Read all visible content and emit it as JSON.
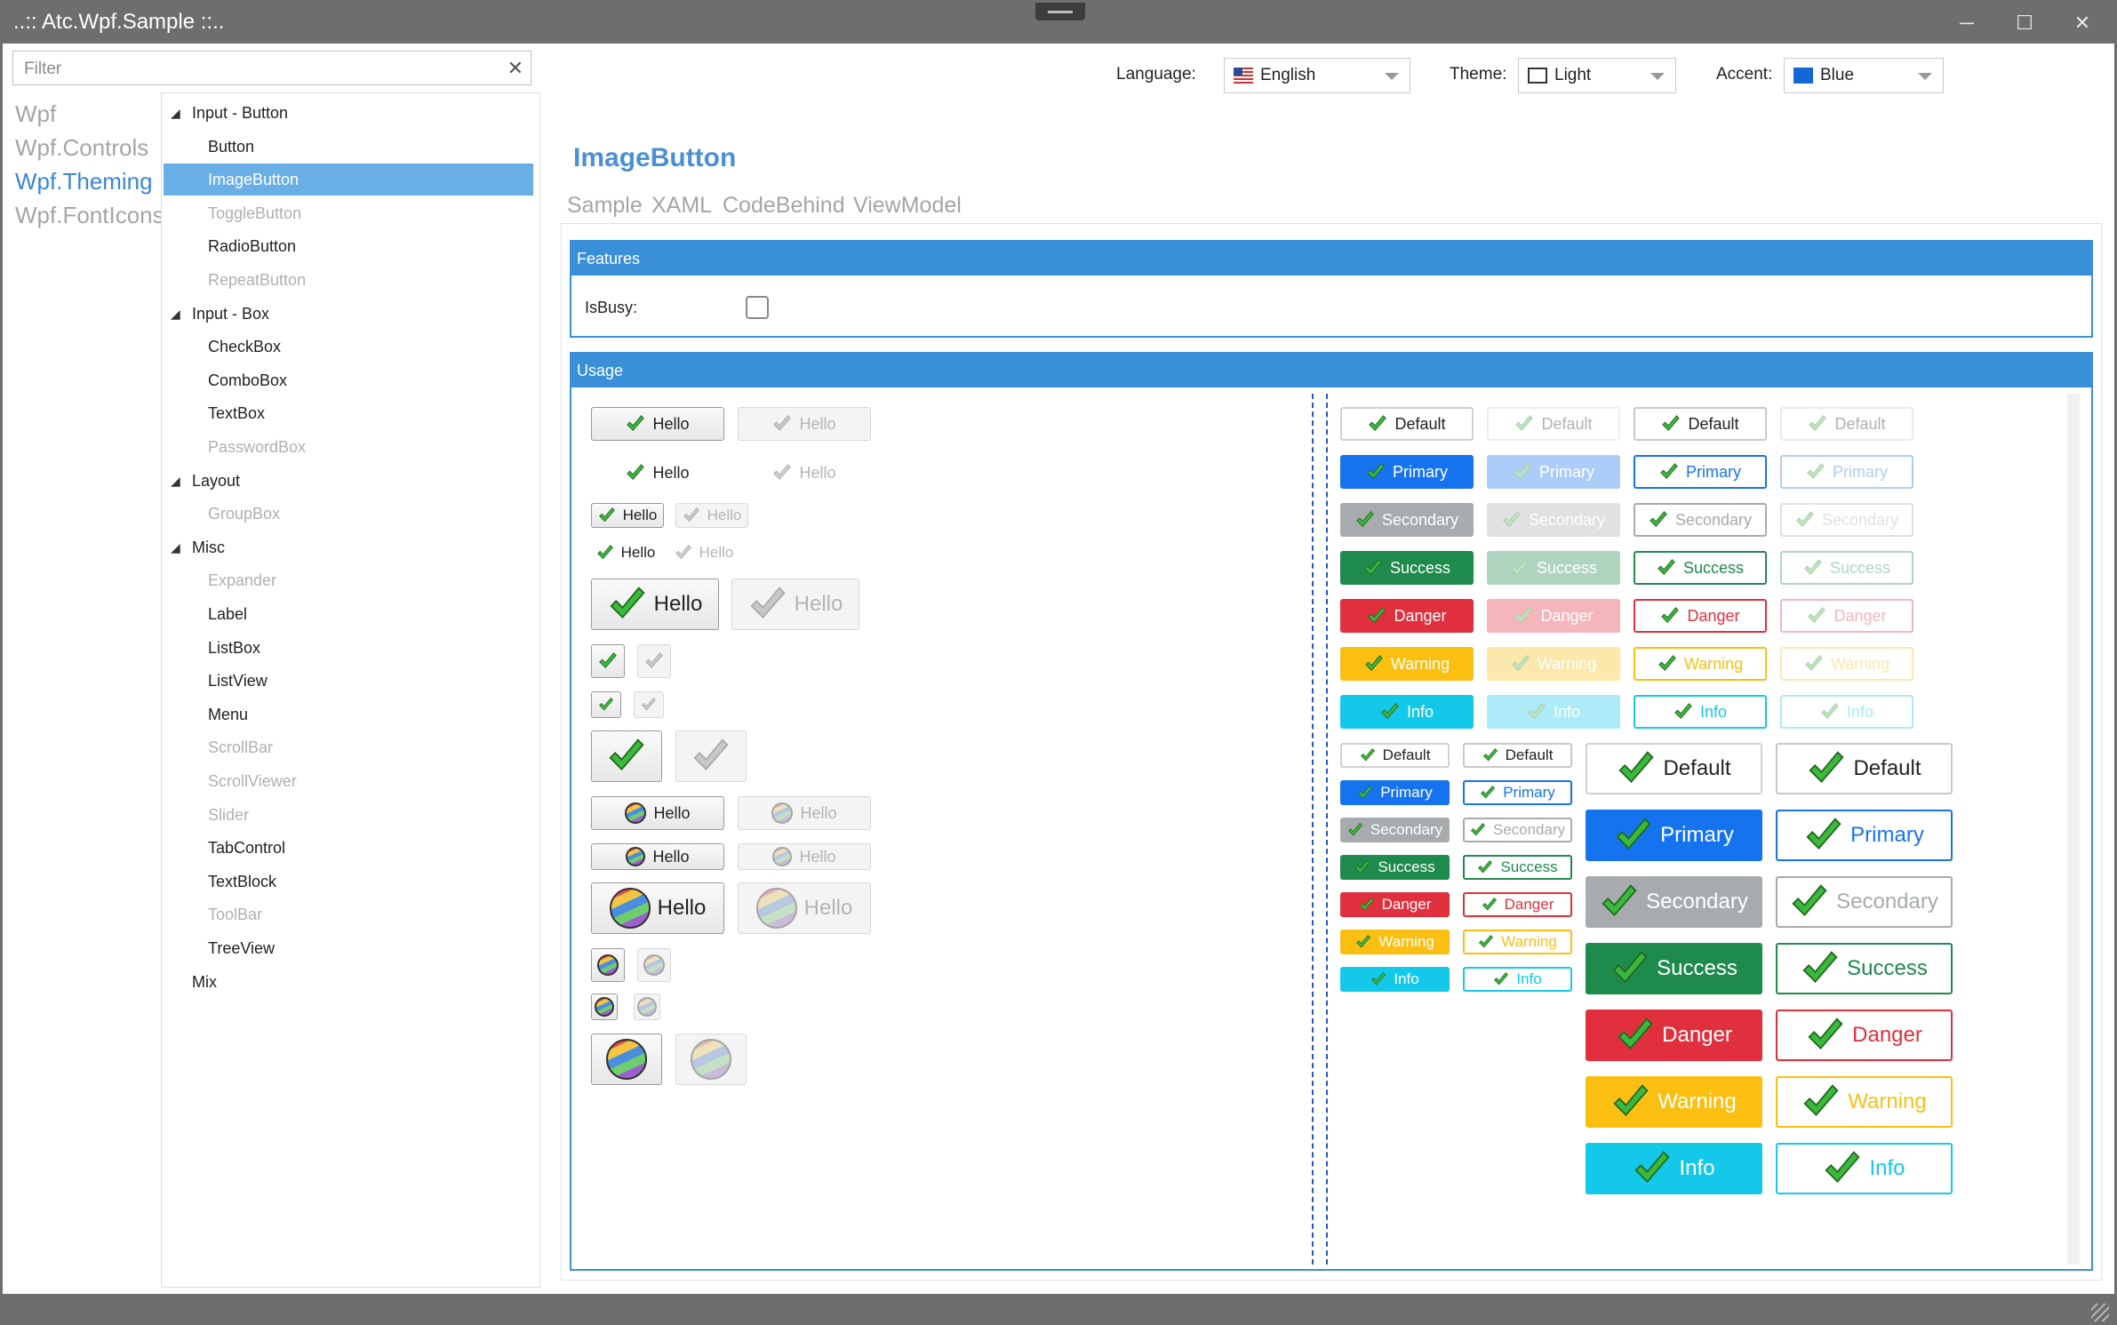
{
  "window": {
    "title": "..:: Atc.Wpf.Sample ::..",
    "minimize": "─",
    "maximize": "☐",
    "close": "✕"
  },
  "filter": {
    "placeholder": "Filter",
    "clear": "✕"
  },
  "left_nav": [
    "Wpf",
    "Wpf.Controls",
    "Wpf.Theming",
    "Wpf.FontIcons"
  ],
  "left_nav_active": "Wpf.Theming",
  "tree": [
    {
      "label": "Input - Button",
      "level": 0,
      "expanded": true
    },
    {
      "label": "Button",
      "level": 1
    },
    {
      "label": "ImageButton",
      "level": 1,
      "selected": true
    },
    {
      "label": "ToggleButton",
      "level": 1,
      "disabled": true
    },
    {
      "label": "RadioButton",
      "level": 1
    },
    {
      "label": "RepeatButton",
      "level": 1,
      "disabled": true
    },
    {
      "label": "Input - Box",
      "level": 0,
      "expanded": true
    },
    {
      "label": "CheckBox",
      "level": 1
    },
    {
      "label": "ComboBox",
      "level": 1
    },
    {
      "label": "TextBox",
      "level": 1
    },
    {
      "label": "PasswordBox",
      "level": 1,
      "disabled": true
    },
    {
      "label": "Layout",
      "level": 0,
      "expanded": true
    },
    {
      "label": "GroupBox",
      "level": 1,
      "disabled": true
    },
    {
      "label": "Misc",
      "level": 0,
      "expanded": true
    },
    {
      "label": "Expander",
      "level": 1,
      "disabled": true
    },
    {
      "label": "Label",
      "level": 1
    },
    {
      "label": "ListBox",
      "level": 1
    },
    {
      "label": "ListView",
      "level": 1
    },
    {
      "label": "Menu",
      "level": 1
    },
    {
      "label": "ScrollBar",
      "level": 1,
      "disabled": true
    },
    {
      "label": "ScrollViewer",
      "level": 1,
      "disabled": true
    },
    {
      "label": "Slider",
      "level": 1,
      "disabled": true
    },
    {
      "label": "TabControl",
      "level": 1
    },
    {
      "label": "TextBlock",
      "level": 1
    },
    {
      "label": "ToolBar",
      "level": 1,
      "disabled": true
    },
    {
      "label": "TreeView",
      "level": 1
    },
    {
      "label": "Mix",
      "level": 0
    }
  ],
  "topbar": {
    "language_label": "Language:",
    "language_value": "English",
    "theme_label": "Theme:",
    "theme_value": "Light",
    "accent_label": "Accent:",
    "accent_value": "Blue",
    "accent_color": "#1467d6"
  },
  "page": {
    "title": "ImageButton",
    "tabs": [
      "Sample",
      "XAML",
      "CodeBehind",
      "ViewModel"
    ],
    "active_tab": "Sample"
  },
  "features": {
    "header": "Features",
    "isbusy_label": "IsBusy:",
    "isbusy_checked": false
  },
  "usage": {
    "header": "Usage",
    "hello": "Hello"
  },
  "theme_buttons": {
    "styles": [
      "Default",
      "Primary",
      "Secondary",
      "Success",
      "Danger",
      "Warning",
      "Info"
    ],
    "colors": {
      "Default": "#ffffff",
      "Primary": "#1673f0",
      "Secondary": "#a7abae",
      "Success": "#1e8a4c",
      "Danger": "#e0303e",
      "Warning": "#fbbf12",
      "Info": "#14c8ea"
    }
  }
}
